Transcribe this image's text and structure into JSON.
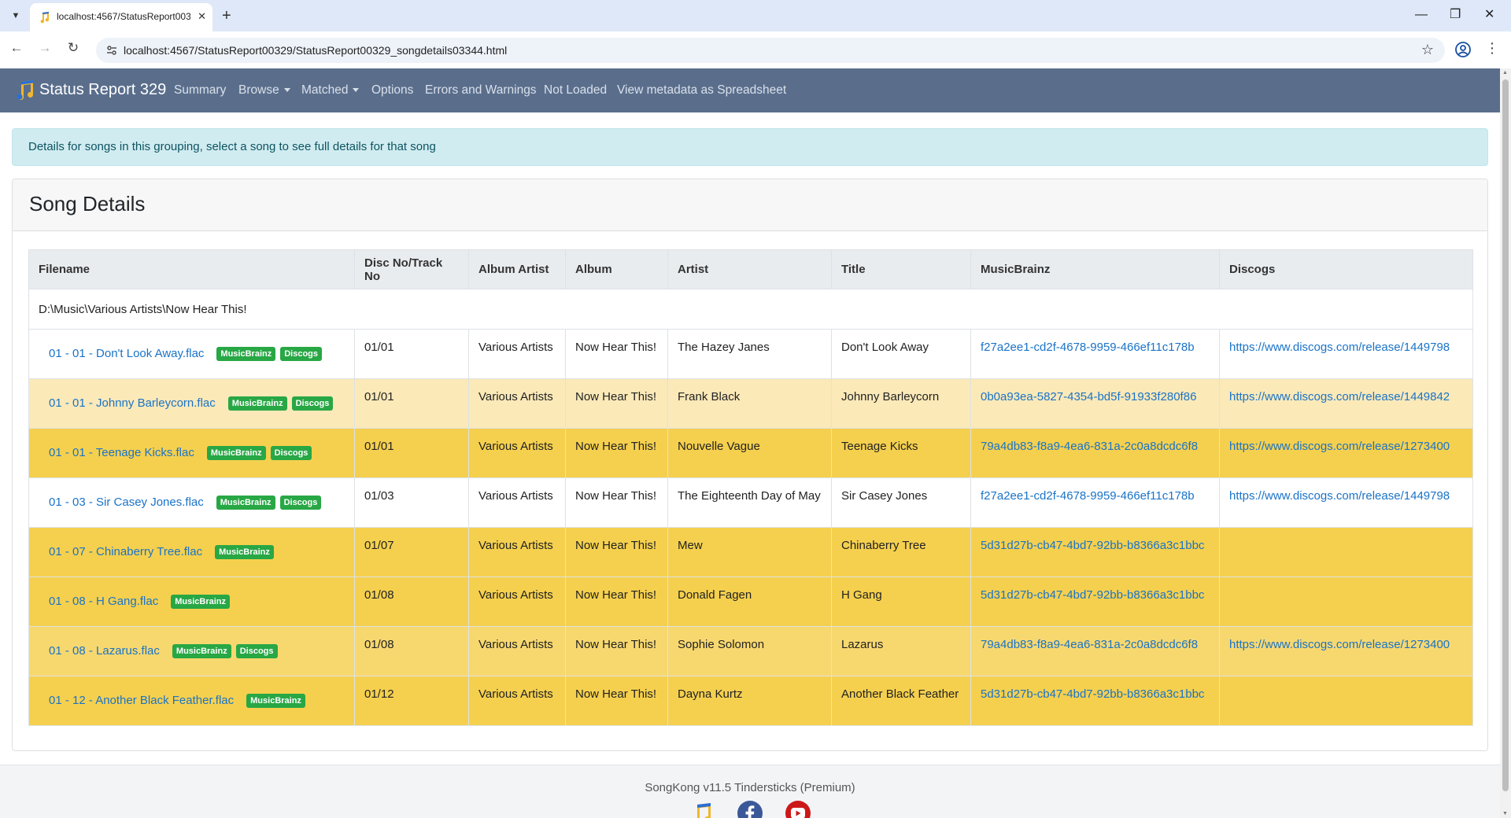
{
  "browser": {
    "tab_title": "localhost:4567/StatusReport00329/StatusRep...",
    "url": "localhost:4567/StatusReport00329/StatusReport00329_songdetails03344.html"
  },
  "nav": {
    "brand": "Status Report 329",
    "links": [
      "Summary",
      "Browse",
      "Matched",
      "Options",
      "Errors and Warnings",
      "Not Loaded",
      "View metadata as Spreadsheet"
    ]
  },
  "alert": "Details for songs in this grouping, select a song to see full details for that song",
  "card_title": "Song Details",
  "table": {
    "headers": [
      "Filename",
      "Disc No/Track No",
      "Album Artist",
      "Album",
      "Artist",
      "Title",
      "MusicBrainz",
      "Discogs"
    ],
    "group": "D:\\Music\\Various Artists\\Now Hear This!",
    "badges": {
      "mb": "MusicBrainz",
      "dc": "Discogs"
    },
    "rows": [
      {
        "file": "01 - 01 - Don't Look Away.flac",
        "disc": "01/01",
        "album_artist": "Various Artists",
        "album": "Now Hear This!",
        "artist": "The Hazey Janes",
        "title": "Don't Look Away",
        "mb": "f27a2ee1-cd2f-4678-9959-466ef11c178b",
        "dc": "https://www.discogs.com/release/1449798",
        "color": "white"
      },
      {
        "file": "01 - 01 - Johnny Barleycorn.flac",
        "disc": "01/01",
        "album_artist": "Various Artists",
        "album": "Now Hear This!",
        "artist": "Frank Black",
        "title": "Johnny Barleycorn",
        "mb": "0b0a93ea-5827-4354-bd5f-91933f280f86",
        "dc": "https://www.discogs.com/release/1449842",
        "color": "pale"
      },
      {
        "file": "01 - 01 - Teenage Kicks.flac",
        "disc": "01/01",
        "album_artist": "Various Artists",
        "album": "Now Hear This!",
        "artist": "Nouvelle Vague",
        "title": "Teenage Kicks",
        "mb": "79a4db83-f8a9-4ea6-831a-2c0a8dcdc6f8",
        "dc": "https://www.discogs.com/release/1273400",
        "color": "gold"
      },
      {
        "file": "01 - 03 - Sir Casey Jones.flac",
        "disc": "01/03",
        "album_artist": "Various Artists",
        "album": "Now Hear This!",
        "artist": "The Eighteenth Day of May",
        "title": "Sir Casey Jones",
        "mb": "f27a2ee1-cd2f-4678-9959-466ef11c178b",
        "dc": "https://www.discogs.com/release/1449798",
        "color": "white"
      },
      {
        "file": "01 - 07 - Chinaberry Tree.flac",
        "disc": "01/07",
        "album_artist": "Various Artists",
        "album": "Now Hear This!",
        "artist": "Mew",
        "title": "Chinaberry Tree",
        "mb": "5d31d27b-cb47-4bd7-92bb-b8366a3c1bbc",
        "dc": "",
        "color": "gold"
      },
      {
        "file": "01 - 08 - H Gang.flac",
        "disc": "01/08",
        "album_artist": "Various Artists",
        "album": "Now Hear This!",
        "artist": "Donald Fagen",
        "title": "H Gang",
        "mb": "5d31d27b-cb47-4bd7-92bb-b8366a3c1bbc",
        "dc": "",
        "color": "gold"
      },
      {
        "file": "01 - 08 - Lazarus.flac",
        "disc": "01/08",
        "album_artist": "Various Artists",
        "album": "Now Hear This!",
        "artist": "Sophie Solomon",
        "title": "Lazarus",
        "mb": "79a4db83-f8a9-4ea6-831a-2c0a8dcdc6f8",
        "dc": "https://www.discogs.com/release/1273400",
        "color": "mid"
      },
      {
        "file": "01 - 12 - Another Black Feather.flac",
        "disc": "01/12",
        "album_artist": "Various Artists",
        "album": "Now Hear This!",
        "artist": "Dayna Kurtz",
        "title": "Another Black Feather",
        "mb": "5d31d27b-cb47-4bd7-92bb-b8366a3c1bbc",
        "dc": "",
        "color": "gold"
      }
    ]
  },
  "footer": "SongKong v11.5 Tindersticks (Premium)",
  "icons": {
    "favicon": "songkong-note-icon",
    "facebook": "facebook-icon",
    "youtube": "youtube-icon"
  },
  "colors": {
    "nav_bg": "#5a6e8c",
    "link": "#1a73c8",
    "badge": "#28a745",
    "row_pale": "#fbe9b8",
    "row_mid": "#f7d86f",
    "row_gold": "#f5d04e"
  }
}
